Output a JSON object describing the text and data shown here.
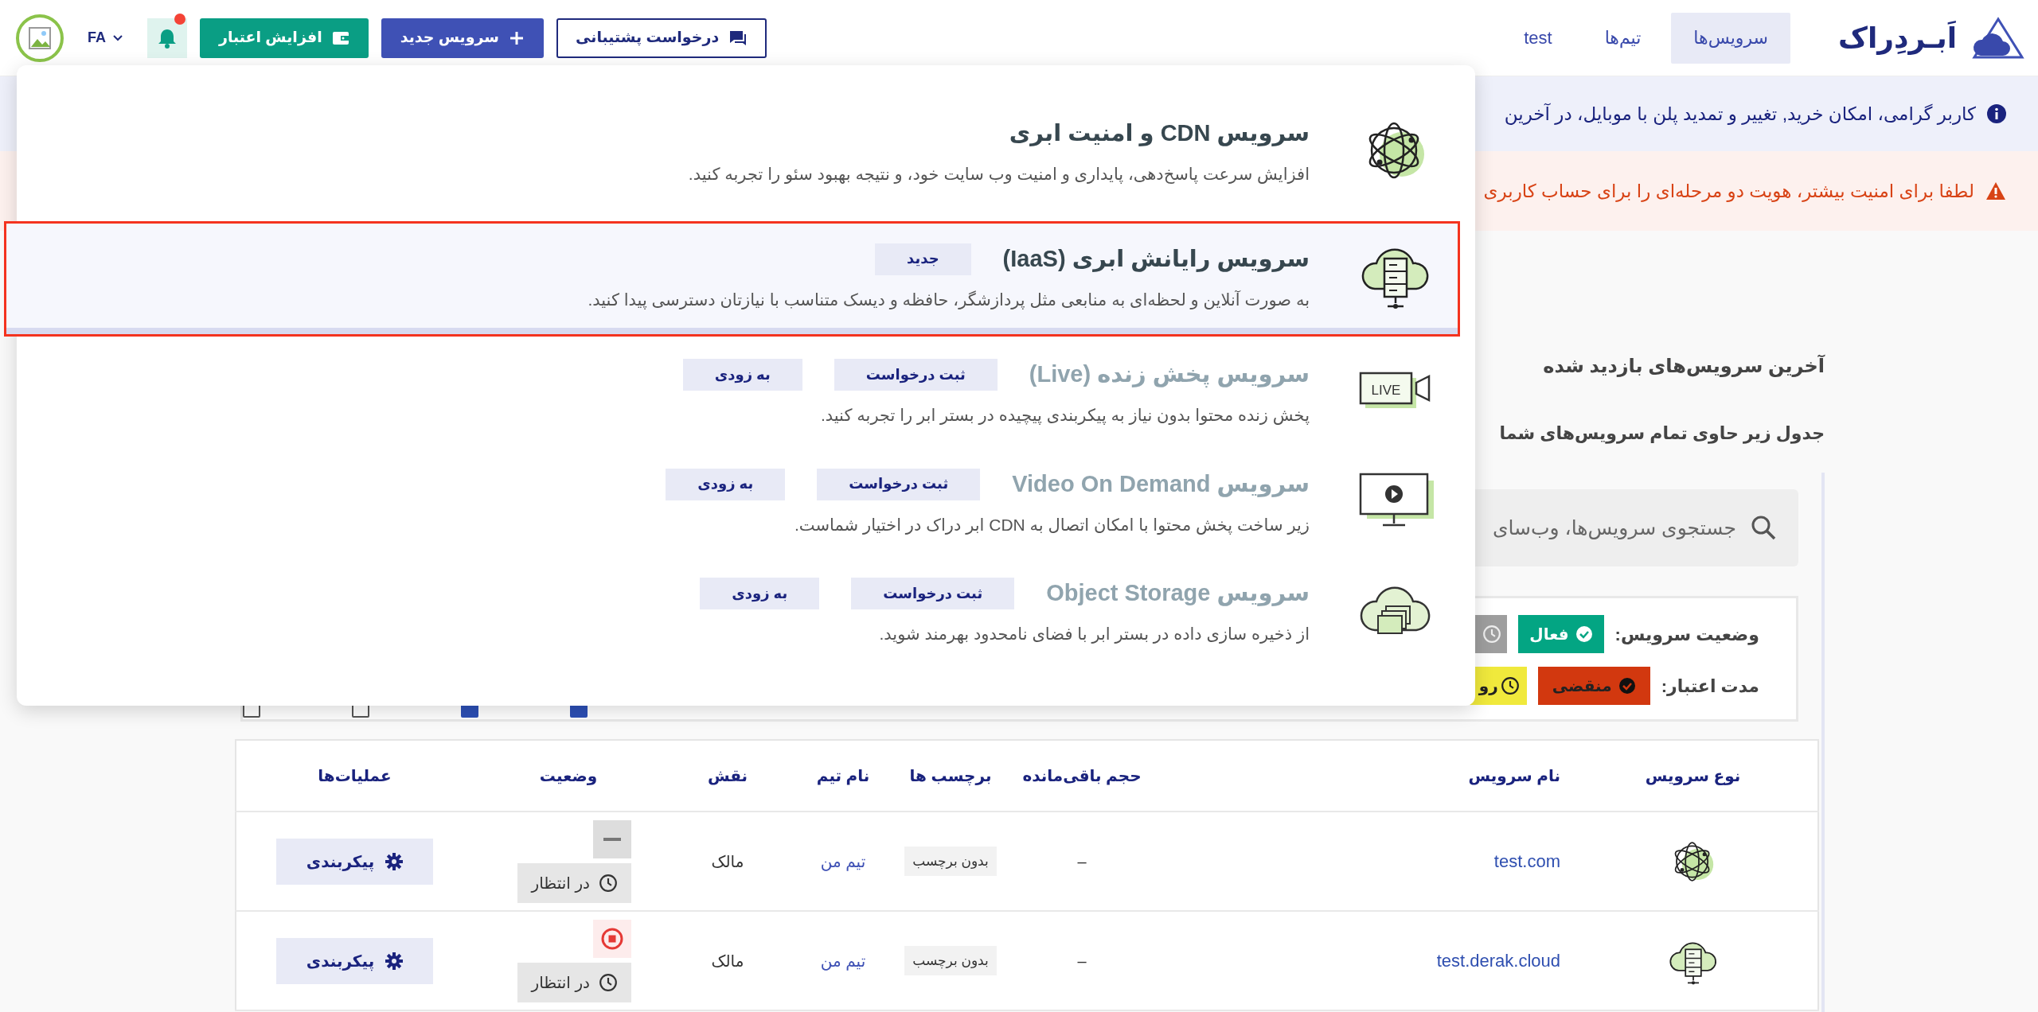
{
  "header": {
    "logo": "اَبـردِراک",
    "nav": [
      {
        "label": "سرویس‌ها",
        "selected": true
      },
      {
        "label": "تیم‌ها",
        "selected": false
      },
      {
        "label": "test",
        "selected": false
      }
    ],
    "buttons": [
      {
        "kind": "support",
        "label": "درخواست پشتیبانی"
      },
      {
        "kind": "new",
        "label": "سرویس جدید"
      },
      {
        "kind": "credit",
        "label": "افزایش اعتبار"
      }
    ],
    "notifications": {
      "has_unread": true
    },
    "language": "FA"
  },
  "alerts": [
    {
      "kind": "info",
      "text": "کاربر گرامی، امکان خرید, تغییر و تمدید پلن با موبایل، در آخرین"
    },
    {
      "kind": "warning",
      "text": "لطفا برای امنیت بیشتر، هویت دو مرحله‌ای را برای حساب کاربری"
    }
  ],
  "recent_heading": "آخرین سرویس‌های بازدید شده",
  "table_intro": "جدول زیر حاوی تمام سرویس‌های شما",
  "search": {
    "placeholder": "جستجوی سرویس‌ها، وب‌سای"
  },
  "filters": [
    {
      "label": "وضعیت سرویس:",
      "options": [
        {
          "kind": "active",
          "label": "فعال"
        },
        {
          "kind": "pending"
        }
      ]
    },
    {
      "label": "مدت اعتبار:",
      "options": [
        {
          "kind": "expired",
          "label": "منقضی"
        },
        {
          "kind": "expiring",
          "label": "رو"
        }
      ]
    }
  ],
  "filter_checkboxes": [
    {
      "checked": true
    },
    {
      "checked": true
    },
    {
      "checked": false
    },
    {
      "checked": false
    }
  ],
  "table": {
    "columns": [
      "نوع سرویس",
      "نام سرویس",
      "حجم باقی‌مانده",
      "برچسب ها",
      "نام تیم",
      "نقش",
      "وضعیت",
      "عملیات‌ها"
    ],
    "rows": [
      {
        "kind": "cdn",
        "name": "test.com",
        "remaining": "–",
        "tag": "بدون برچسب",
        "team": "تیم من",
        "role": "مالک",
        "action": {
          "kind": "minus"
        },
        "status": "در انتظار",
        "operation": "پیکربندی"
      },
      {
        "kind": "iaas",
        "name": "test.derak.cloud",
        "remaining": "–",
        "tag": "بدون برچسب",
        "team": "تیم من",
        "role": "مالک",
        "action": {
          "kind": "stop"
        },
        "status": "در انتظار",
        "operation": "پیکربندی"
      }
    ]
  },
  "service_menu": {
    "items": [
      {
        "kind": "cdn",
        "title": "سرویس CDN و امنیت ابری",
        "description": "افزایش سرعت پاسخ‌دهی، پایداری و امنیت وب سایت خود، و نتیجه بهبود سئو را تجربه کنید.",
        "selected": false,
        "disabled": false
      },
      {
        "kind": "iaas",
        "title": "سرویس رایانش ابری (IaaS)",
        "badges": [
          "جدید"
        ],
        "description": "به صورت آنلاین و لحظه‌ای به منابعی مثل پردازشگر، حافظه و دیسک متناسب با نیازتان دسترسی پیدا کنید.",
        "selected": true,
        "disabled": false
      },
      {
        "kind": "live",
        "icon_label": "LIVE",
        "title": "سرویس پخش زنده (Live)",
        "badges": [
          "ثبت درخواست",
          "به زودی"
        ],
        "description": "پخش زنده محتوا بدون نیاز به پیکربندی پیچیده در بستر ابر را تجربه کنید.",
        "selected": false,
        "disabled": true
      },
      {
        "kind": "vod",
        "title": "سرویس Video On Demand",
        "badges": [
          "ثبت درخواست",
          "به زودی"
        ],
        "description": "زیر ساخت پخش محتوا با امکان اتصال به CDN ابر دراک در اختیار شماست.",
        "selected": false,
        "disabled": true
      },
      {
        "kind": "storage",
        "title": "سرویس Object Storage",
        "badges": [
          "ثبت درخواست",
          "به زودی"
        ],
        "description": "از ذخیره سازی داده در بستر ابر با فضای نامحدود بهرمند شوید.",
        "selected": false,
        "disabled": true
      }
    ]
  }
}
